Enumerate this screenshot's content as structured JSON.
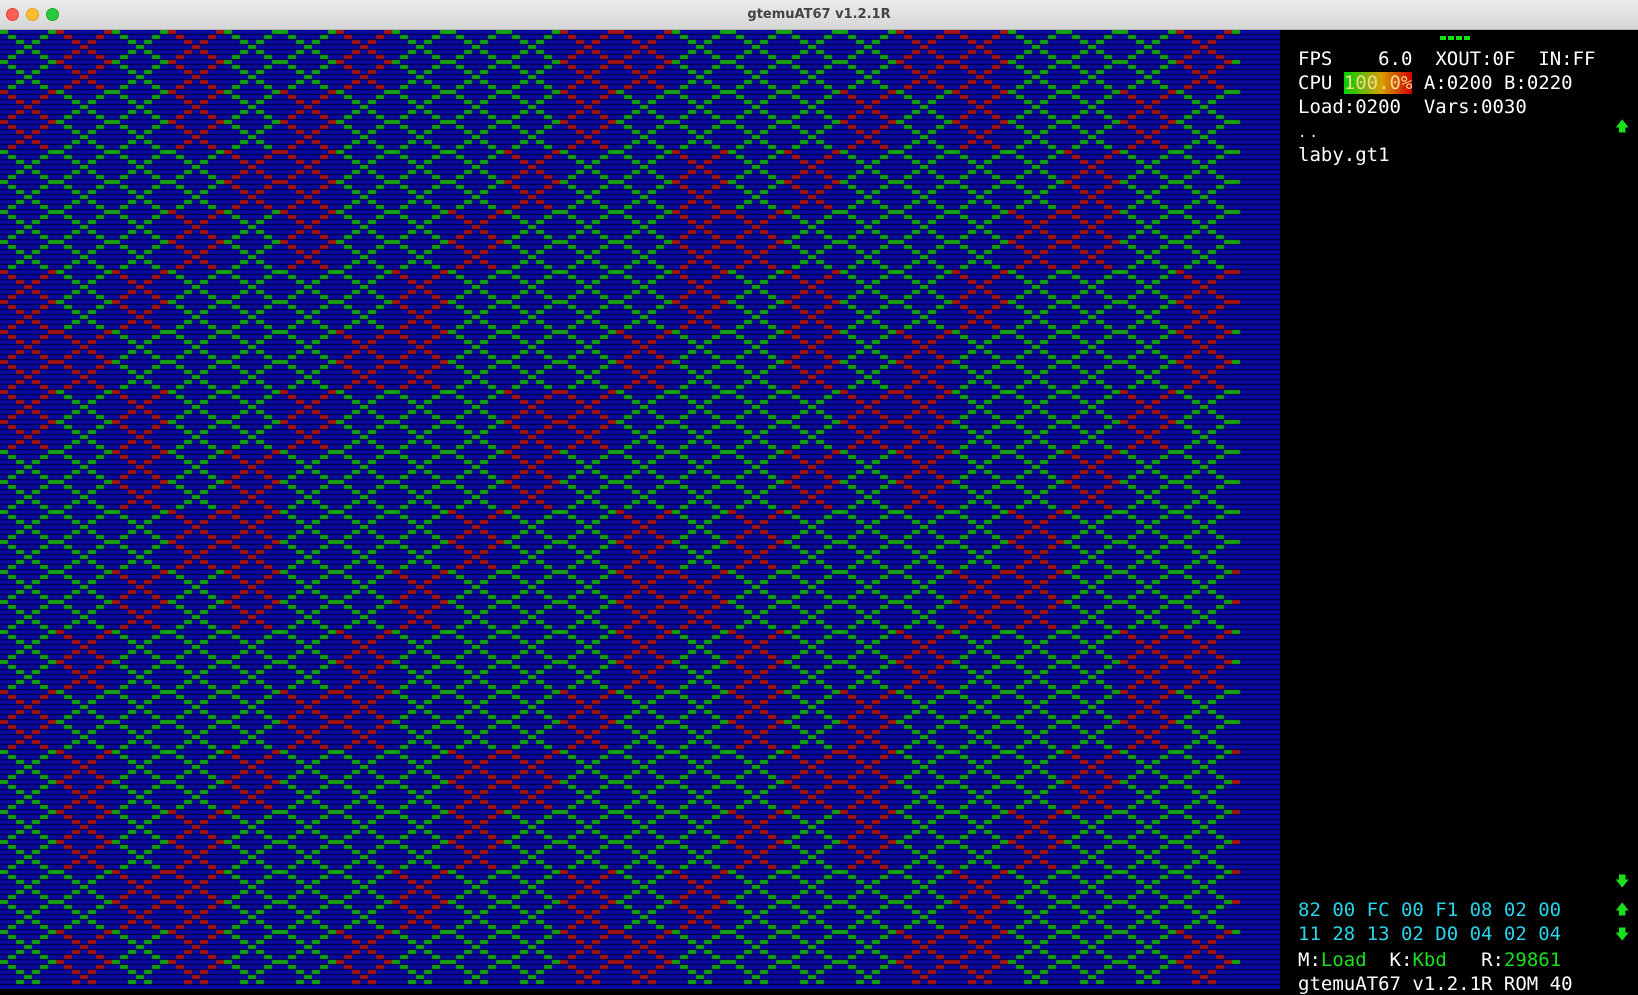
{
  "window": {
    "title": "gtemuAT67 v1.2.1R"
  },
  "screen": {
    "colors": {
      "background": "#0a0aa0",
      "scanline": "#000030",
      "green": "#14a414",
      "red": "#a41414"
    }
  },
  "panel": {
    "fps_label": "FPS",
    "fps_value": "6.0",
    "xout": "XOUT:0F",
    "in": "IN:FF",
    "cpu_label": "CPU",
    "cpu_value": "100.0%",
    "a_reg": "A:0200",
    "b_reg": "B:0220",
    "load": "Load:0200",
    "vars": "Vars:0030",
    "browser_parent": "..",
    "browser_file": "laby.gt1",
    "hex_row1": "82 00 FC 00 F1 08 02 00",
    "hex_row2": "11 28 13 02 D0 04 02 04",
    "mode_label": "M:",
    "mode_value": "Load",
    "kbd_label": "K:",
    "kbd_value": "Kbd",
    "rom_label": "R:",
    "rom_value": "29861",
    "footer": "gtemuAT67 v1.2.1R ROM 40",
    "scroll_up_icon": "up-arrow",
    "scroll_down_icon": "down-arrow"
  }
}
